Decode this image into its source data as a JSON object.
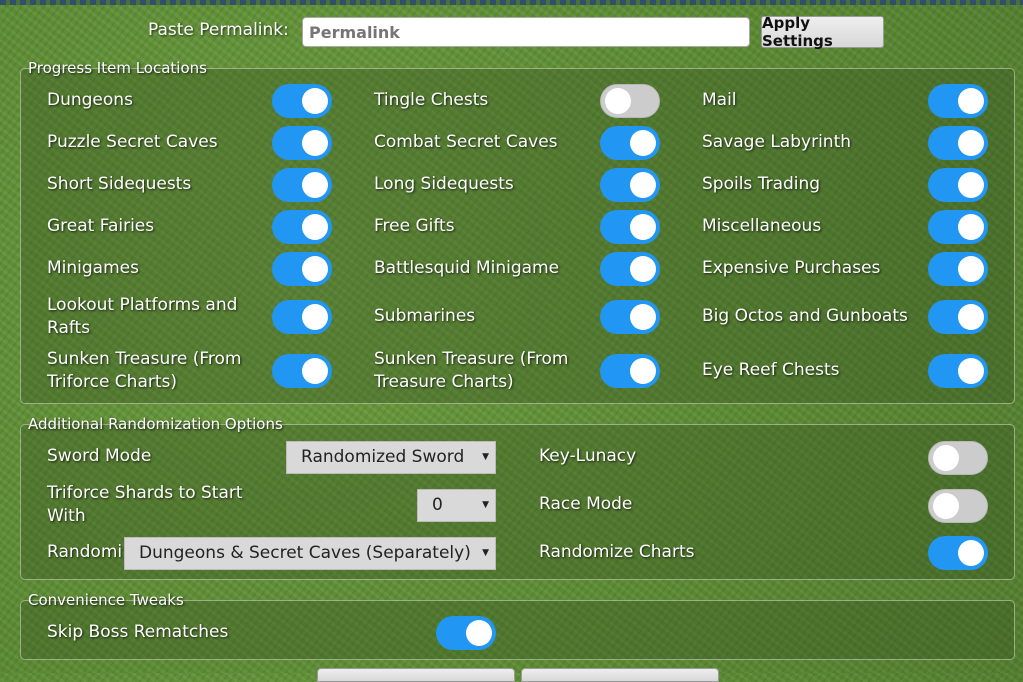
{
  "permalink": {
    "label": "Paste Permalink:",
    "placeholder": "Permalink",
    "value": "Permalink",
    "apply_label": "Apply Settings"
  },
  "progress": {
    "legend": "Progress Item Locations",
    "items": [
      {
        "label": "Dungeons",
        "on": true
      },
      {
        "label": "Tingle Chests",
        "on": false
      },
      {
        "label": "Mail",
        "on": true
      },
      {
        "label": "Puzzle Secret Caves",
        "on": true
      },
      {
        "label": "Combat Secret Caves",
        "on": true
      },
      {
        "label": "Savage Labyrinth",
        "on": true
      },
      {
        "label": "Short Sidequests",
        "on": true
      },
      {
        "label": "Long Sidequests",
        "on": true
      },
      {
        "label": "Spoils Trading",
        "on": true
      },
      {
        "label": "Great Fairies",
        "on": true
      },
      {
        "label": "Free Gifts",
        "on": true
      },
      {
        "label": "Miscellaneous",
        "on": true
      },
      {
        "label": "Minigames",
        "on": true
      },
      {
        "label": "Battlesquid Minigame",
        "on": true
      },
      {
        "label": "Expensive Purchases",
        "on": true
      },
      {
        "label_line1": "Lookout Platforms and",
        "label_line2": "Rafts",
        "on": true
      },
      {
        "label": "Submarines",
        "on": true
      },
      {
        "label": "Big Octos and Gunboats",
        "on": true
      },
      {
        "label_line1": "Sunken Treasure (From",
        "label_line2": "Triforce Charts)",
        "on": true
      },
      {
        "label_line1": "Sunken Treasure (From",
        "label_line2": "Treasure Charts)",
        "on": true
      },
      {
        "label": "Eye Reef Chests",
        "on": true
      }
    ]
  },
  "additional": {
    "legend": "Additional Randomization Options",
    "sword_mode": {
      "label": "Sword Mode",
      "value": "Randomized Sword"
    },
    "triforce": {
      "label_line1": "Triforce Shards to Start",
      "label_line2": "With",
      "value": "0"
    },
    "entrances": {
      "label": "Randomi",
      "value": "Dungeons & Secret Caves (Separately)"
    },
    "key_lunacy": {
      "label": "Key-Lunacy",
      "on": false
    },
    "race_mode": {
      "label": "Race Mode",
      "on": false
    },
    "randomize_charts": {
      "label": "Randomize Charts",
      "on": true
    }
  },
  "convenience": {
    "legend": "Convenience Tweaks",
    "skip_boss": {
      "label": "Skip Boss Rematches",
      "on": true
    }
  },
  "colors": {
    "toggle_on": "#2196f3",
    "toggle_off": "#cccccc",
    "background": "#5b8a32"
  }
}
